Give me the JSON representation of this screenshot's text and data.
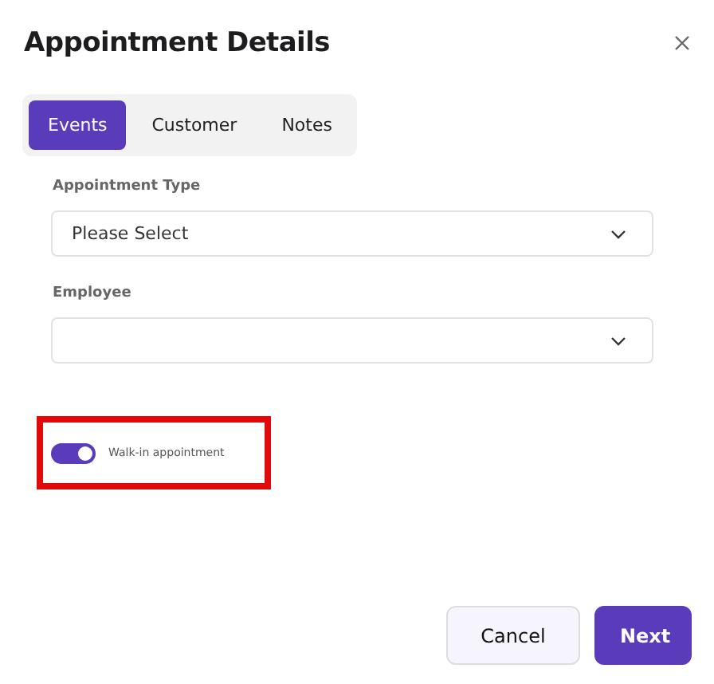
{
  "dialog": {
    "title": "Appointment Details"
  },
  "tabs": [
    {
      "label": "Events",
      "selected": true
    },
    {
      "label": "Customer",
      "selected": false
    },
    {
      "label": "Notes",
      "selected": false
    }
  ],
  "fields": [
    {
      "label": "Appointment Type",
      "value": "Please Select"
    },
    {
      "label": "Employee"
    }
  ],
  "walk_in": {
    "label": "Walk-in appointment",
    "on": true,
    "highlighted": true
  },
  "buttons": [
    {
      "label": "Cancel",
      "kind": "secondary"
    },
    {
      "label": "Next",
      "kind": "primary"
    }
  ]
}
